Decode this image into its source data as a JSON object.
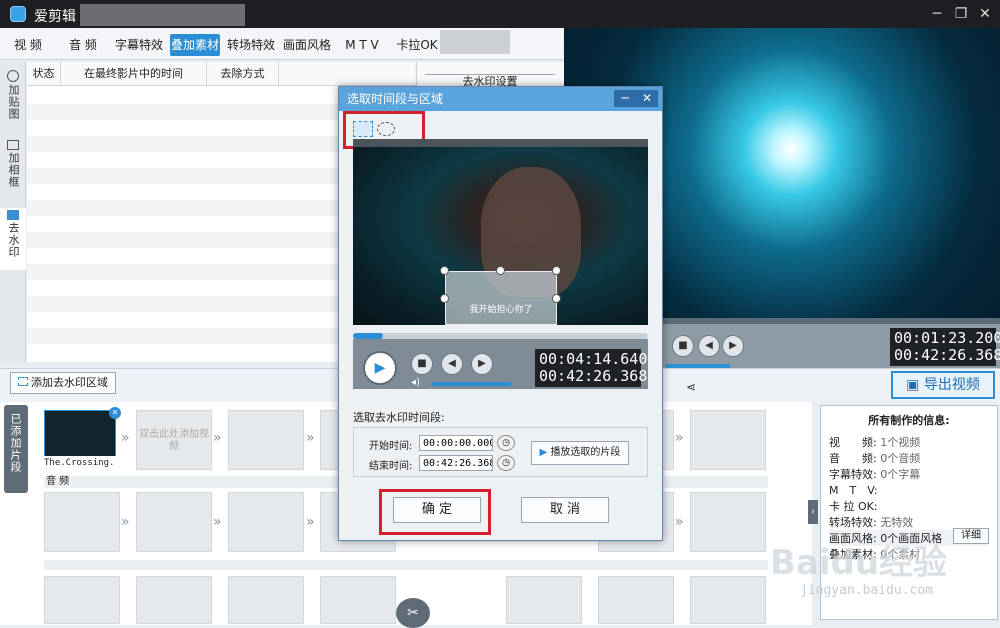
{
  "app": {
    "title": "爱剪辑"
  },
  "tabs": [
    "视 频",
    "音 频",
    "字幕特效",
    "叠加素材",
    "转场特效",
    "画面风格",
    "M T V",
    "卡拉OK"
  ],
  "side_tabs": [
    "加贴图",
    "加相框",
    "去水印"
  ],
  "table": {
    "headers": [
      "状态",
      "在最终影片中的时间",
      "去除方式"
    ]
  },
  "right_panel": {
    "title": "去水印设置"
  },
  "preview": {
    "time_current": "00:01:23.200",
    "time_total": "00:42:26.368"
  },
  "toolbar": {
    "add_watermark": "添加去水印区域",
    "export": "导出视频"
  },
  "timeline": {
    "added_label": "已添加片段",
    "clip_name": "The.Crossing..",
    "placeholder": "双击此处添加视频",
    "audio_label": "音 频"
  },
  "info": {
    "title": "所有制作的信息:",
    "rows": [
      {
        "k": "视　　频:",
        "v": "1个视频"
      },
      {
        "k": "音　　频:",
        "v": "0个音频"
      },
      {
        "k": "字幕特效:",
        "v": "0个字幕"
      },
      {
        "k": "M　T　V:",
        "v": ""
      },
      {
        "k": "卡 拉 OK:",
        "v": ""
      },
      {
        "k": "转场特效:",
        "v": "无特效"
      },
      {
        "k": "画面风格:",
        "v": "0个画面风格"
      },
      {
        "k": "叠加素材:",
        "v": "0个素材"
      }
    ],
    "detail_button": "详细"
  },
  "dialog": {
    "title": "选取时间段与区域",
    "subtitle_overlay": "我开始担心你了",
    "time_current": "00:04:14.640",
    "time_total": "00:42:26.368",
    "section_title": "选取去水印时间段:",
    "start_label": "开始时间:",
    "start_value": "00:00:00.000",
    "end_label": "结束时间:",
    "end_value": "00:42:26.368",
    "play_selected": "播放选取的片段",
    "ok": "确 定",
    "cancel": "取 消"
  },
  "watermark": {
    "brand": "Baidu经验",
    "url": "jingyan.baidu.com"
  }
}
